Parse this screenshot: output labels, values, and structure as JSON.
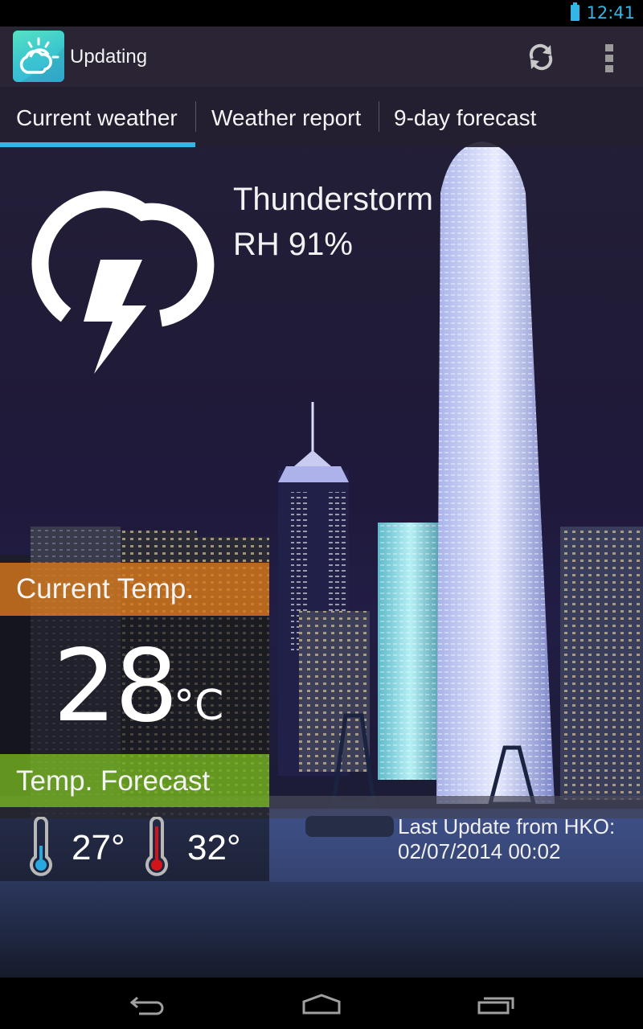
{
  "status_bar": {
    "time": "12:41",
    "battery_icon": "battery-full-icon"
  },
  "action_bar": {
    "app_icon": "cloud-sun-icon",
    "title": "Updating",
    "refresh_icon": "refresh-icon",
    "overflow_icon": "more-vert-icon"
  },
  "tabs": [
    {
      "label": "Current weather",
      "selected": true
    },
    {
      "label": "Weather report",
      "selected": false
    },
    {
      "label": "9-day forecast",
      "selected": false
    }
  ],
  "colors": {
    "accent": "#33b5e5",
    "current_temp_bar": "#d6781a",
    "forecast_bar": "#6eaa1e",
    "min_thermo": "#29a8e0",
    "max_thermo": "#d0141a"
  },
  "weather": {
    "icon": "thunderstorm-icon",
    "condition": "Thunderstorm",
    "humidity": "RH 91%"
  },
  "current_temp": {
    "label": "Current Temp.",
    "value": "28",
    "unit": "°C"
  },
  "forecast": {
    "label": "Temp. Forecast",
    "min": "27°",
    "max": "32°"
  },
  "last_update": {
    "label": "Last Update from HKO:",
    "time": "02/07/2014 00:02"
  },
  "nav_bar": {
    "back_icon": "back-icon",
    "home_icon": "home-icon",
    "recents_icon": "recent-apps-icon"
  }
}
